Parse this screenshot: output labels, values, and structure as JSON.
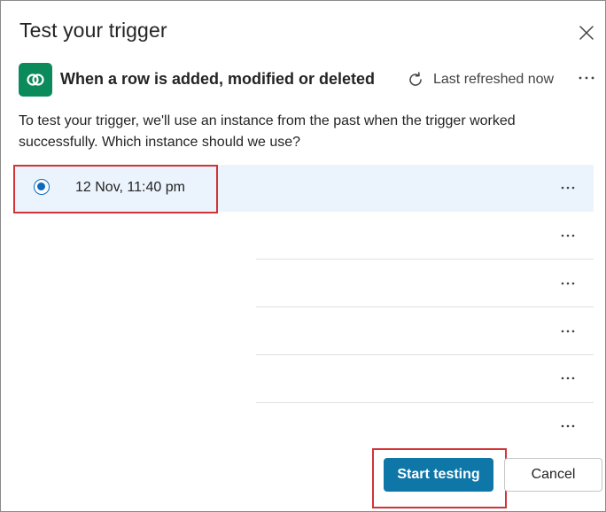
{
  "dialog": {
    "title": "Test your trigger",
    "close_icon": "close-icon"
  },
  "trigger": {
    "connector_icon": "dataverse-icon",
    "connector_color": "#0b8a5b",
    "name": "When a row is added, modified or deleted",
    "refresh_icon": "refresh-icon",
    "refresh_label": "Last refreshed now",
    "more_icon": "more-horizontal-icon"
  },
  "description": "To test your trigger, we'll use an instance from the past when the trigger worked successfully. Which instance should we use?",
  "instances": [
    {
      "label": "12 Nov, 11:40 pm",
      "selected": true
    },
    {
      "label": "",
      "selected": false
    },
    {
      "label": "",
      "selected": false
    },
    {
      "label": "",
      "selected": false
    },
    {
      "label": "",
      "selected": false
    },
    {
      "label": "",
      "selected": false
    }
  ],
  "buttons": {
    "start_label": "Start testing",
    "cancel_label": "Cancel"
  },
  "colors": {
    "primary": "#0f76a8",
    "selected_row": "#ebf3fc",
    "highlight": "#d13438",
    "radio": "#0f6cbd"
  }
}
